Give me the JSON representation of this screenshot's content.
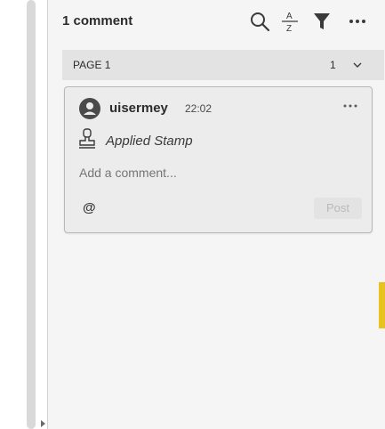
{
  "header": {
    "title": "1 comment",
    "icons": [
      "search-icon",
      "sort-az-icon",
      "filter-icon",
      "more-icon"
    ]
  },
  "page_section": {
    "label": "PAGE 1",
    "count": "1"
  },
  "comment": {
    "username": "uisermey",
    "time": "22:02",
    "action": "Applied Stamp",
    "reply_placeholder": "Add a comment...",
    "mention_symbol": "@",
    "post_label": "Post"
  },
  "colors": {
    "panel_bg": "#f5f5f5",
    "card_bg": "#ececec",
    "accent": "#e8c320"
  }
}
